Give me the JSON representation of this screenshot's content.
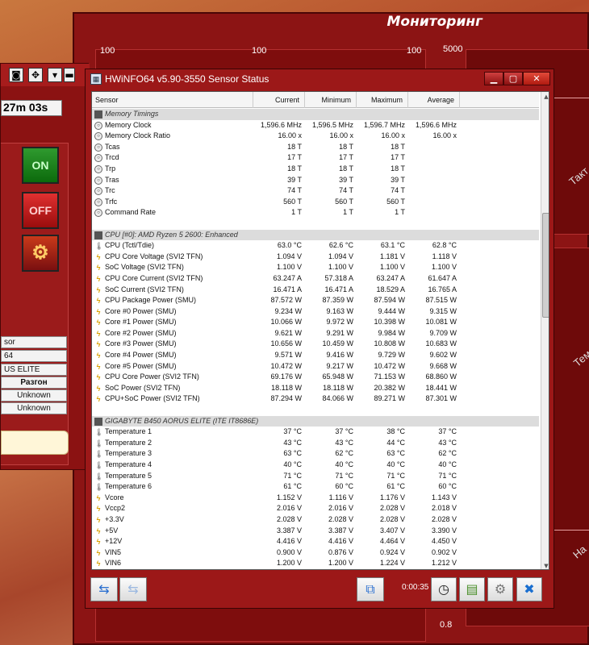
{
  "monitor": {
    "title": "Мониторинг",
    "labels": [
      "100",
      "100",
      "100",
      "5000",
      "0.8"
    ],
    "side_texts": [
      "Такт",
      "Тем",
      "На"
    ]
  },
  "control": {
    "timer": "27m 03s",
    "on_label": "ON",
    "off_label": "OFF",
    "info": [
      "sor",
      "64",
      "US ELITE",
      "Разгон",
      "Unknown",
      "Unknown"
    ]
  },
  "hwinfo": {
    "title": "HWiNFO64 v5.90-3550 Sensor Status",
    "columns": [
      "Sensor",
      "Current",
      "Minimum",
      "Maximum",
      "Average"
    ],
    "elapsed": "0:00:35",
    "rows": [
      {
        "t": "g",
        "n": "Memory Timings"
      },
      {
        "t": "c",
        "n": "Memory Clock",
        "v": [
          "1,596.6 MHz",
          "1,596.5 MHz",
          "1,596.7 MHz",
          "1,596.6 MHz"
        ]
      },
      {
        "t": "c",
        "n": "Memory Clock Ratio",
        "v": [
          "16.00 x",
          "16.00 x",
          "16.00 x",
          "16.00 x"
        ]
      },
      {
        "t": "c",
        "n": "Tcas",
        "v": [
          "18 T",
          "18 T",
          "18 T",
          ""
        ]
      },
      {
        "t": "c",
        "n": "Trcd",
        "v": [
          "17 T",
          "17 T",
          "17 T",
          ""
        ]
      },
      {
        "t": "c",
        "n": "Trp",
        "v": [
          "18 T",
          "18 T",
          "18 T",
          ""
        ]
      },
      {
        "t": "c",
        "n": "Tras",
        "v": [
          "39 T",
          "39 T",
          "39 T",
          ""
        ]
      },
      {
        "t": "c",
        "n": "Trc",
        "v": [
          "74 T",
          "74 T",
          "74 T",
          ""
        ]
      },
      {
        "t": "c",
        "n": "Trfc",
        "v": [
          "560 T",
          "560 T",
          "560 T",
          ""
        ]
      },
      {
        "t": "c",
        "n": "Command Rate",
        "v": [
          "1 T",
          "1 T",
          "1 T",
          ""
        ]
      },
      {
        "t": "b"
      },
      {
        "t": "g",
        "n": "CPU [#0]: AMD Ryzen 5 2600: Enhanced"
      },
      {
        "t": "tmp",
        "n": "CPU (Tctl/Tdie)",
        "v": [
          "63.0 °C",
          "62.6 °C",
          "63.1 °C",
          "62.8 °C"
        ]
      },
      {
        "t": "v",
        "n": "CPU Core Voltage (SVI2 TFN)",
        "v": [
          "1.094 V",
          "1.094 V",
          "1.181 V",
          "1.118 V"
        ]
      },
      {
        "t": "v",
        "n": "SoC Voltage (SVI2 TFN)",
        "v": [
          "1.100 V",
          "1.100 V",
          "1.100 V",
          "1.100 V"
        ]
      },
      {
        "t": "v",
        "n": "CPU Core Current (SVI2 TFN)",
        "v": [
          "63.247 A",
          "57.318 A",
          "63.247 A",
          "61.647 A"
        ]
      },
      {
        "t": "v",
        "n": "SoC Current (SVI2 TFN)",
        "v": [
          "16.471 A",
          "16.471 A",
          "18.529 A",
          "16.765 A"
        ]
      },
      {
        "t": "v",
        "n": "CPU Package Power (SMU)",
        "v": [
          "87.572 W",
          "87.359 W",
          "87.594 W",
          "87.515 W"
        ]
      },
      {
        "t": "v",
        "n": "Core #0 Power (SMU)",
        "v": [
          "9.234 W",
          "9.163 W",
          "9.444 W",
          "9.315 W"
        ]
      },
      {
        "t": "v",
        "n": "Core #1 Power (SMU)",
        "v": [
          "10.066 W",
          "9.972 W",
          "10.398 W",
          "10.081 W"
        ]
      },
      {
        "t": "v",
        "n": "Core #2 Power (SMU)",
        "v": [
          "9.621 W",
          "9.291 W",
          "9.984 W",
          "9.709 W"
        ]
      },
      {
        "t": "v",
        "n": "Core #3 Power (SMU)",
        "v": [
          "10.656 W",
          "10.459 W",
          "10.808 W",
          "10.683 W"
        ]
      },
      {
        "t": "v",
        "n": "Core #4 Power (SMU)",
        "v": [
          "9.571 W",
          "9.416 W",
          "9.729 W",
          "9.602 W"
        ]
      },
      {
        "t": "v",
        "n": "Core #5 Power (SMU)",
        "v": [
          "10.472 W",
          "9.217 W",
          "10.472 W",
          "9.668 W"
        ]
      },
      {
        "t": "v",
        "n": "CPU Core Power (SVI2 TFN)",
        "v": [
          "69.176 W",
          "65.948 W",
          "71.153 W",
          "68.860 W"
        ]
      },
      {
        "t": "v",
        "n": "SoC Power (SVI2 TFN)",
        "v": [
          "18.118 W",
          "18.118 W",
          "20.382 W",
          "18.441 W"
        ]
      },
      {
        "t": "v",
        "n": "CPU+SoC Power (SVI2 TFN)",
        "v": [
          "87.294 W",
          "84.066 W",
          "89.271 W",
          "87.301 W"
        ]
      },
      {
        "t": "b"
      },
      {
        "t": "g",
        "n": "GIGABYTE B450 AORUS ELITE (ITE IT8686E)"
      },
      {
        "t": "tmp",
        "n": "Temperature 1",
        "v": [
          "37 °C",
          "37 °C",
          "38 °C",
          "37 °C"
        ]
      },
      {
        "t": "tmp",
        "n": "Temperature 2",
        "v": [
          "43 °C",
          "43 °C",
          "44 °C",
          "43 °C"
        ]
      },
      {
        "t": "tmp",
        "n": "Temperature 3",
        "v": [
          "63 °C",
          "62 °C",
          "63 °C",
          "62 °C"
        ]
      },
      {
        "t": "tmp",
        "n": "Temperature 4",
        "v": [
          "40 °C",
          "40 °C",
          "40 °C",
          "40 °C"
        ]
      },
      {
        "t": "tmp",
        "n": "Temperature 5",
        "v": [
          "71 °C",
          "71 °C",
          "71 °C",
          "71 °C"
        ]
      },
      {
        "t": "tmp",
        "n": "Temperature 6",
        "v": [
          "61 °C",
          "60 °C",
          "61 °C",
          "60 °C"
        ]
      },
      {
        "t": "v",
        "n": "Vcore",
        "v": [
          "1.152 V",
          "1.116 V",
          "1.176 V",
          "1.143 V"
        ]
      },
      {
        "t": "v",
        "n": "Vccp2",
        "v": [
          "2.016 V",
          "2.016 V",
          "2.028 V",
          "2.018 V"
        ]
      },
      {
        "t": "v",
        "n": "+3.3V",
        "v": [
          "2.028 V",
          "2.028 V",
          "2.028 V",
          "2.028 V"
        ]
      },
      {
        "t": "v",
        "n": "+5V",
        "v": [
          "3.387 V",
          "3.387 V",
          "3.407 V",
          "3.390 V"
        ]
      },
      {
        "t": "v",
        "n": "+12V",
        "v": [
          "4.416 V",
          "4.416 V",
          "4.464 V",
          "4.450 V"
        ]
      },
      {
        "t": "v",
        "n": "VIN5",
        "v": [
          "0.900 V",
          "0.876 V",
          "0.924 V",
          "0.902 V"
        ]
      },
      {
        "t": "v",
        "n": "VIN6",
        "v": [
          "1.200 V",
          "1.200 V",
          "1.224 V",
          "1.212 V"
        ]
      }
    ]
  }
}
